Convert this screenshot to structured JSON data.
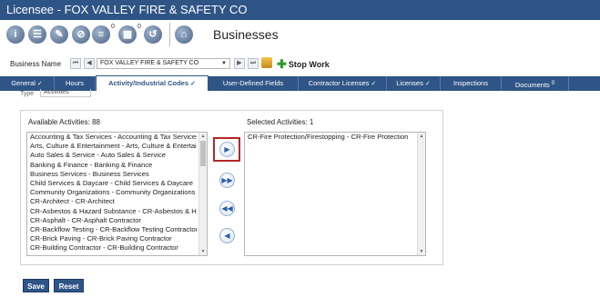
{
  "window": {
    "title": "Licensee - FOX VALLEY FIRE & SAFETY CO"
  },
  "toolbar": {
    "icons": [
      "info-icon",
      "contacts-icon",
      "attachments-icon",
      "notes-icon",
      "documents-icon",
      "calendar-icon",
      "history-icon",
      "businesses-icon"
    ],
    "documents_badge": "0",
    "calendar_badge": "0",
    "label": "Businesses"
  },
  "business": {
    "label": "Business Name",
    "selected": "FOX VALLEY FIRE & SAFETY CO",
    "stop_work_label": "Stop Work"
  },
  "tabs": [
    {
      "label": "General",
      "check": "✓"
    },
    {
      "label": "Hours",
      "check": ""
    },
    {
      "label": "Activity/Industrial Codes",
      "check": "✓"
    },
    {
      "label": "User-Defined Fields",
      "check": ""
    },
    {
      "label": "Contractor Licenses",
      "check": "✓"
    },
    {
      "label": "Licenses",
      "check": "✓"
    },
    {
      "label": "Inspections",
      "check": ""
    },
    {
      "label": "Documents",
      "badge": "0"
    }
  ],
  "type_field": {
    "label": "Type",
    "value": "Activities"
  },
  "available": {
    "header": "Available Activities: 88",
    "items": [
      "Accounting & Tax Services - Accounting & Tax Services",
      "Arts, Culture & Entertainment - Arts, Culture & Entertainment",
      "Auto Sales & Service - Auto Sales & Service",
      "Banking & Finance - Banking & Finance",
      "Business Services - Business Services",
      "Child Services & Daycare - Child Services & Daycare",
      "Community Organizations - Community Organizations",
      "CR-Architect - CR-Architect",
      "CR-Asbestos & Hazard Substance - CR-Asbestos & Hazard Substance",
      "CR-Asphalt - CR-Asphalt Contractor",
      "CR-Backflow Testing - CR-Backflow Testing Contractor",
      "CR-Brick Paving - CR-Brick Paving Contractor",
      "CR-Building Contractor - CR-Building Contractor"
    ]
  },
  "selected": {
    "header": "Selected Activities: 1",
    "items": [
      "CR-Fire Protection/Firestopping - CR-Fire Protection"
    ]
  },
  "move_buttons": {
    "add": "▶",
    "add_all": "▶▶",
    "remove_all": "◀◀",
    "remove": "◀"
  },
  "actions": {
    "save": "Save",
    "reset": "Reset"
  }
}
